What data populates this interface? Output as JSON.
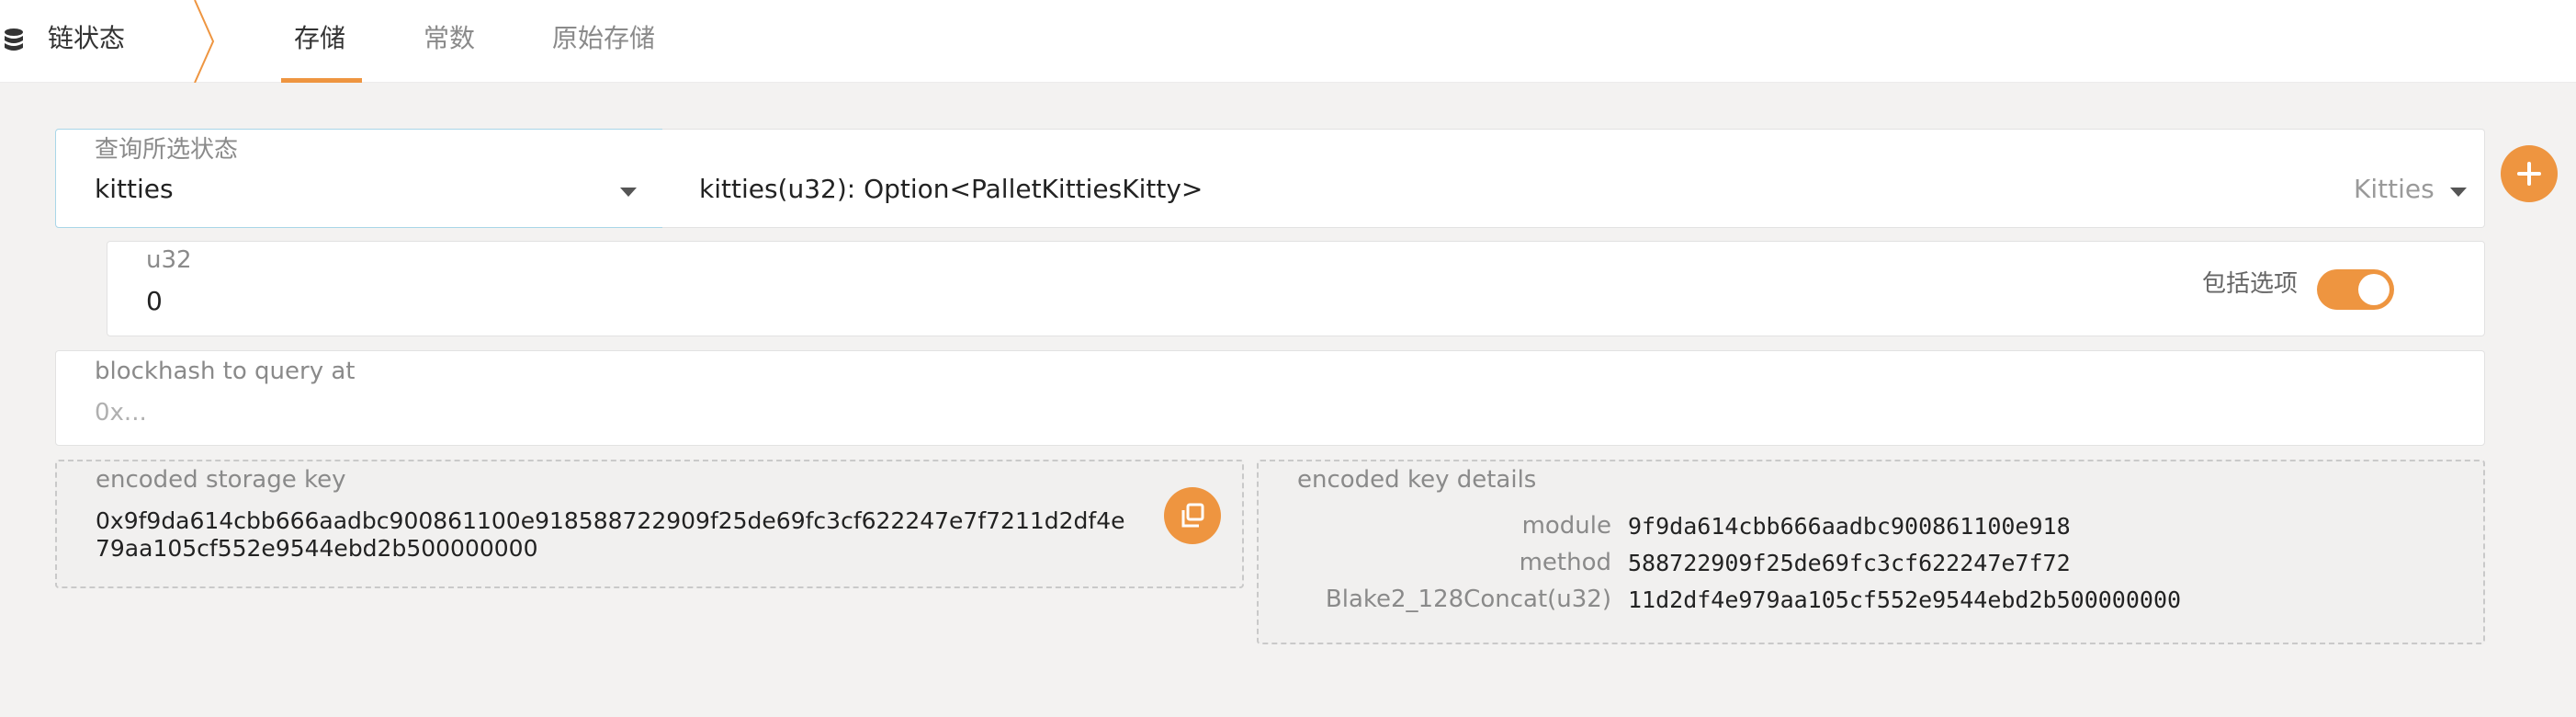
{
  "header": {
    "app_title": "链状态",
    "app_icon": "database-icon",
    "tabs": [
      {
        "label": "存储",
        "active": true
      },
      {
        "label": "常数",
        "active": false
      },
      {
        "label": "原始存储",
        "active": false
      }
    ]
  },
  "query": {
    "section_label": "查询所选状态",
    "module_value": "kitties",
    "method_value": "kitties(u32): Option<PalletKittiesKitty>",
    "section_value": "Kitties",
    "add_icon": "plus-icon"
  },
  "param": {
    "label": "u32",
    "value": "0",
    "include_option_label": "包括选项",
    "include_option_on": true
  },
  "blockhash": {
    "label": "blockhash to query at",
    "placeholder": "0x..."
  },
  "encoded_key": {
    "label": "encoded storage key",
    "line1": "0x9f9da614cbb666aadbc900861100e918588722909f25de69fc3cf622247e7f7211d2df4e",
    "line2": "79aa105cf552e9544ebd2b500000000",
    "copy_icon": "copy-icon"
  },
  "key_details": {
    "label": "encoded key details",
    "rows": [
      {
        "name": "module",
        "value": "9f9da614cbb666aadbc900861100e918"
      },
      {
        "name": "method",
        "value": "588722909f25de69fc3cf622247e7f72"
      },
      {
        "name": "Blake2_128Concat(u32)",
        "value": "11d2df4e979aa105cf552e9544ebd2b500000000"
      }
    ]
  },
  "colors": {
    "accent": "#ee9540",
    "background": "#f3f2f1",
    "focus_border": "#a9d6e8"
  }
}
